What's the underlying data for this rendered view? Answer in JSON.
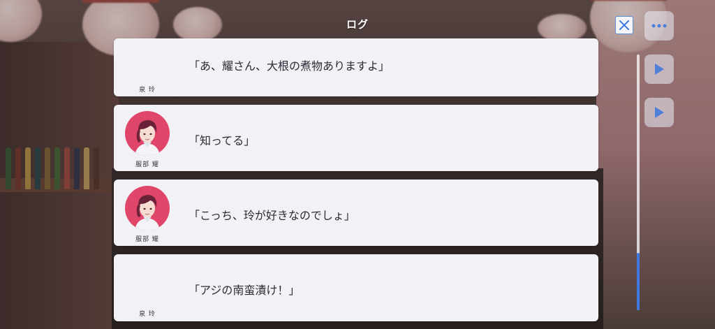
{
  "header": {
    "title": "ログ"
  },
  "close_button": {
    "icon": "close-icon"
  },
  "side_menu": [
    {
      "icon": "more-dots-icon"
    },
    {
      "icon": "play-icon"
    },
    {
      "icon": "play-icon"
    }
  ],
  "log": {
    "entries": [
      {
        "speaker": "泉 玲",
        "text": "「あ、耀さん、大根の煮物ありますよ」",
        "has_avatar": false
      },
      {
        "speaker": "服部 耀",
        "text": "「知ってる」",
        "has_avatar": true
      },
      {
        "speaker": "服部 耀",
        "text": "「こっち、玲が好きなのでしょ」",
        "has_avatar": true
      },
      {
        "speaker": "泉 玲",
        "text": "「アジの南蛮漬け！」",
        "has_avatar": false
      }
    ]
  },
  "scrollbar": {
    "position": "bottom"
  },
  "colors": {
    "card": "#f1f1f6",
    "avatar_bg": "#e0456a",
    "scroll_thumb": "#3f79e0",
    "close_border": "#5b8fd8"
  }
}
